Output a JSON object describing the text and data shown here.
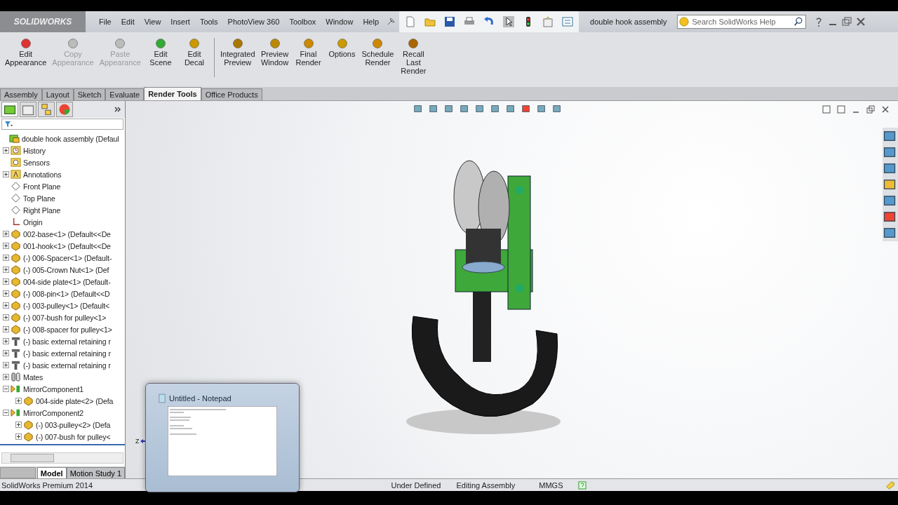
{
  "app": {
    "logo": "SOLIDWORKS",
    "document_title": "double hook assembly",
    "help_search": {
      "placeholder": "Search SolidWorks Help"
    }
  },
  "menu": [
    "File",
    "Edit",
    "View",
    "Insert",
    "Tools",
    "PhotoView 360",
    "Toolbox",
    "Window",
    "Help"
  ],
  "commands": [
    {
      "label": "Edit Appearance",
      "disabled": false
    },
    {
      "label": "Copy Appearance",
      "disabled": true
    },
    {
      "label": "Paste Appearance",
      "disabled": true
    },
    {
      "label": "Edit Scene",
      "disabled": false
    },
    {
      "label": "Edit Decal",
      "disabled": false
    },
    {
      "label": "Integrated Preview",
      "disabled": false
    },
    {
      "label": "Preview Window",
      "disabled": false
    },
    {
      "label": "Final Render",
      "disabled": false
    },
    {
      "label": "Options",
      "disabled": false
    },
    {
      "label": "Schedule Render",
      "disabled": false
    },
    {
      "label": "Recall Last Render",
      "disabled": false
    }
  ],
  "tabs": [
    {
      "label": "Assembly",
      "selected": false
    },
    {
      "label": "Layout",
      "selected": false
    },
    {
      "label": "Sketch",
      "selected": false
    },
    {
      "label": "Evaluate",
      "selected": false
    },
    {
      "label": "Render Tools",
      "selected": true
    },
    {
      "label": "Office Products",
      "selected": false
    }
  ],
  "tree": {
    "label": "double hook assembly  (Defaul",
    "kind": "assembly",
    "children": [
      {
        "label": "History",
        "kind": "history",
        "expanded": false
      },
      {
        "label": "Sensors",
        "kind": "sensors"
      },
      {
        "label": "Annotations",
        "kind": "annotations",
        "expanded": false
      },
      {
        "label": "Front Plane",
        "kind": "plane"
      },
      {
        "label": "Top Plane",
        "kind": "plane"
      },
      {
        "label": "Right Plane",
        "kind": "plane"
      },
      {
        "label": "Origin",
        "kind": "origin"
      },
      {
        "label": "002-base<1> (Default<<De",
        "kind": "part",
        "expanded": false
      },
      {
        "label": "001-hook<1> (Default<<De",
        "kind": "part",
        "expanded": false
      },
      {
        "label": "(-) 006-Spacer<1> (Default-",
        "kind": "part",
        "expanded": false
      },
      {
        "label": "(-) 005-Crown Nut<1> (Def",
        "kind": "part",
        "expanded": false
      },
      {
        "label": "004-side plate<1> (Default-",
        "kind": "part",
        "expanded": false
      },
      {
        "label": "(-) 008-pin<1> (Default<<D",
        "kind": "part",
        "expanded": false
      },
      {
        "label": "(-) 003-pulley<1> (Default<",
        "kind": "part",
        "expanded": false
      },
      {
        "label": "(-) 007-bush for pulley<1>",
        "kind": "part",
        "expanded": false
      },
      {
        "label": "(-) 008-spacer for pulley<1>",
        "kind": "part",
        "expanded": false
      },
      {
        "label": "(-) basic external retaining r",
        "kind": "fastener",
        "expanded": false
      },
      {
        "label": "(-) basic external retaining r",
        "kind": "fastener",
        "expanded": false
      },
      {
        "label": "(-) basic external retaining r",
        "kind": "fastener",
        "expanded": false
      },
      {
        "label": "Mates",
        "kind": "mates",
        "expanded": false
      },
      {
        "label": "MirrorComponent1",
        "kind": "mirror",
        "expanded": true,
        "children": [
          {
            "label": "004-side plate<2> (Defa",
            "kind": "part",
            "expanded": false
          }
        ]
      },
      {
        "label": "MirrorComponent2",
        "kind": "mirror",
        "expanded": true,
        "children": [
          {
            "label": "(-) 003-pulley<2> (Defa",
            "kind": "part",
            "expanded": false
          },
          {
            "label": "(-) 007-bush for pulley<",
            "kind": "part",
            "expanded": false
          }
        ]
      }
    ]
  },
  "bottom_tabs": [
    {
      "label": "Model",
      "selected": true
    },
    {
      "label": "Motion Study 1",
      "selected": false
    }
  ],
  "notepad_preview": {
    "title": "Untitled - Notepad"
  },
  "axis_label": "Z",
  "status_bar": {
    "product": "SolidWorks Premium 2014",
    "state": "Under Defined",
    "mode": "Editing Assembly",
    "units": "MMGS"
  }
}
